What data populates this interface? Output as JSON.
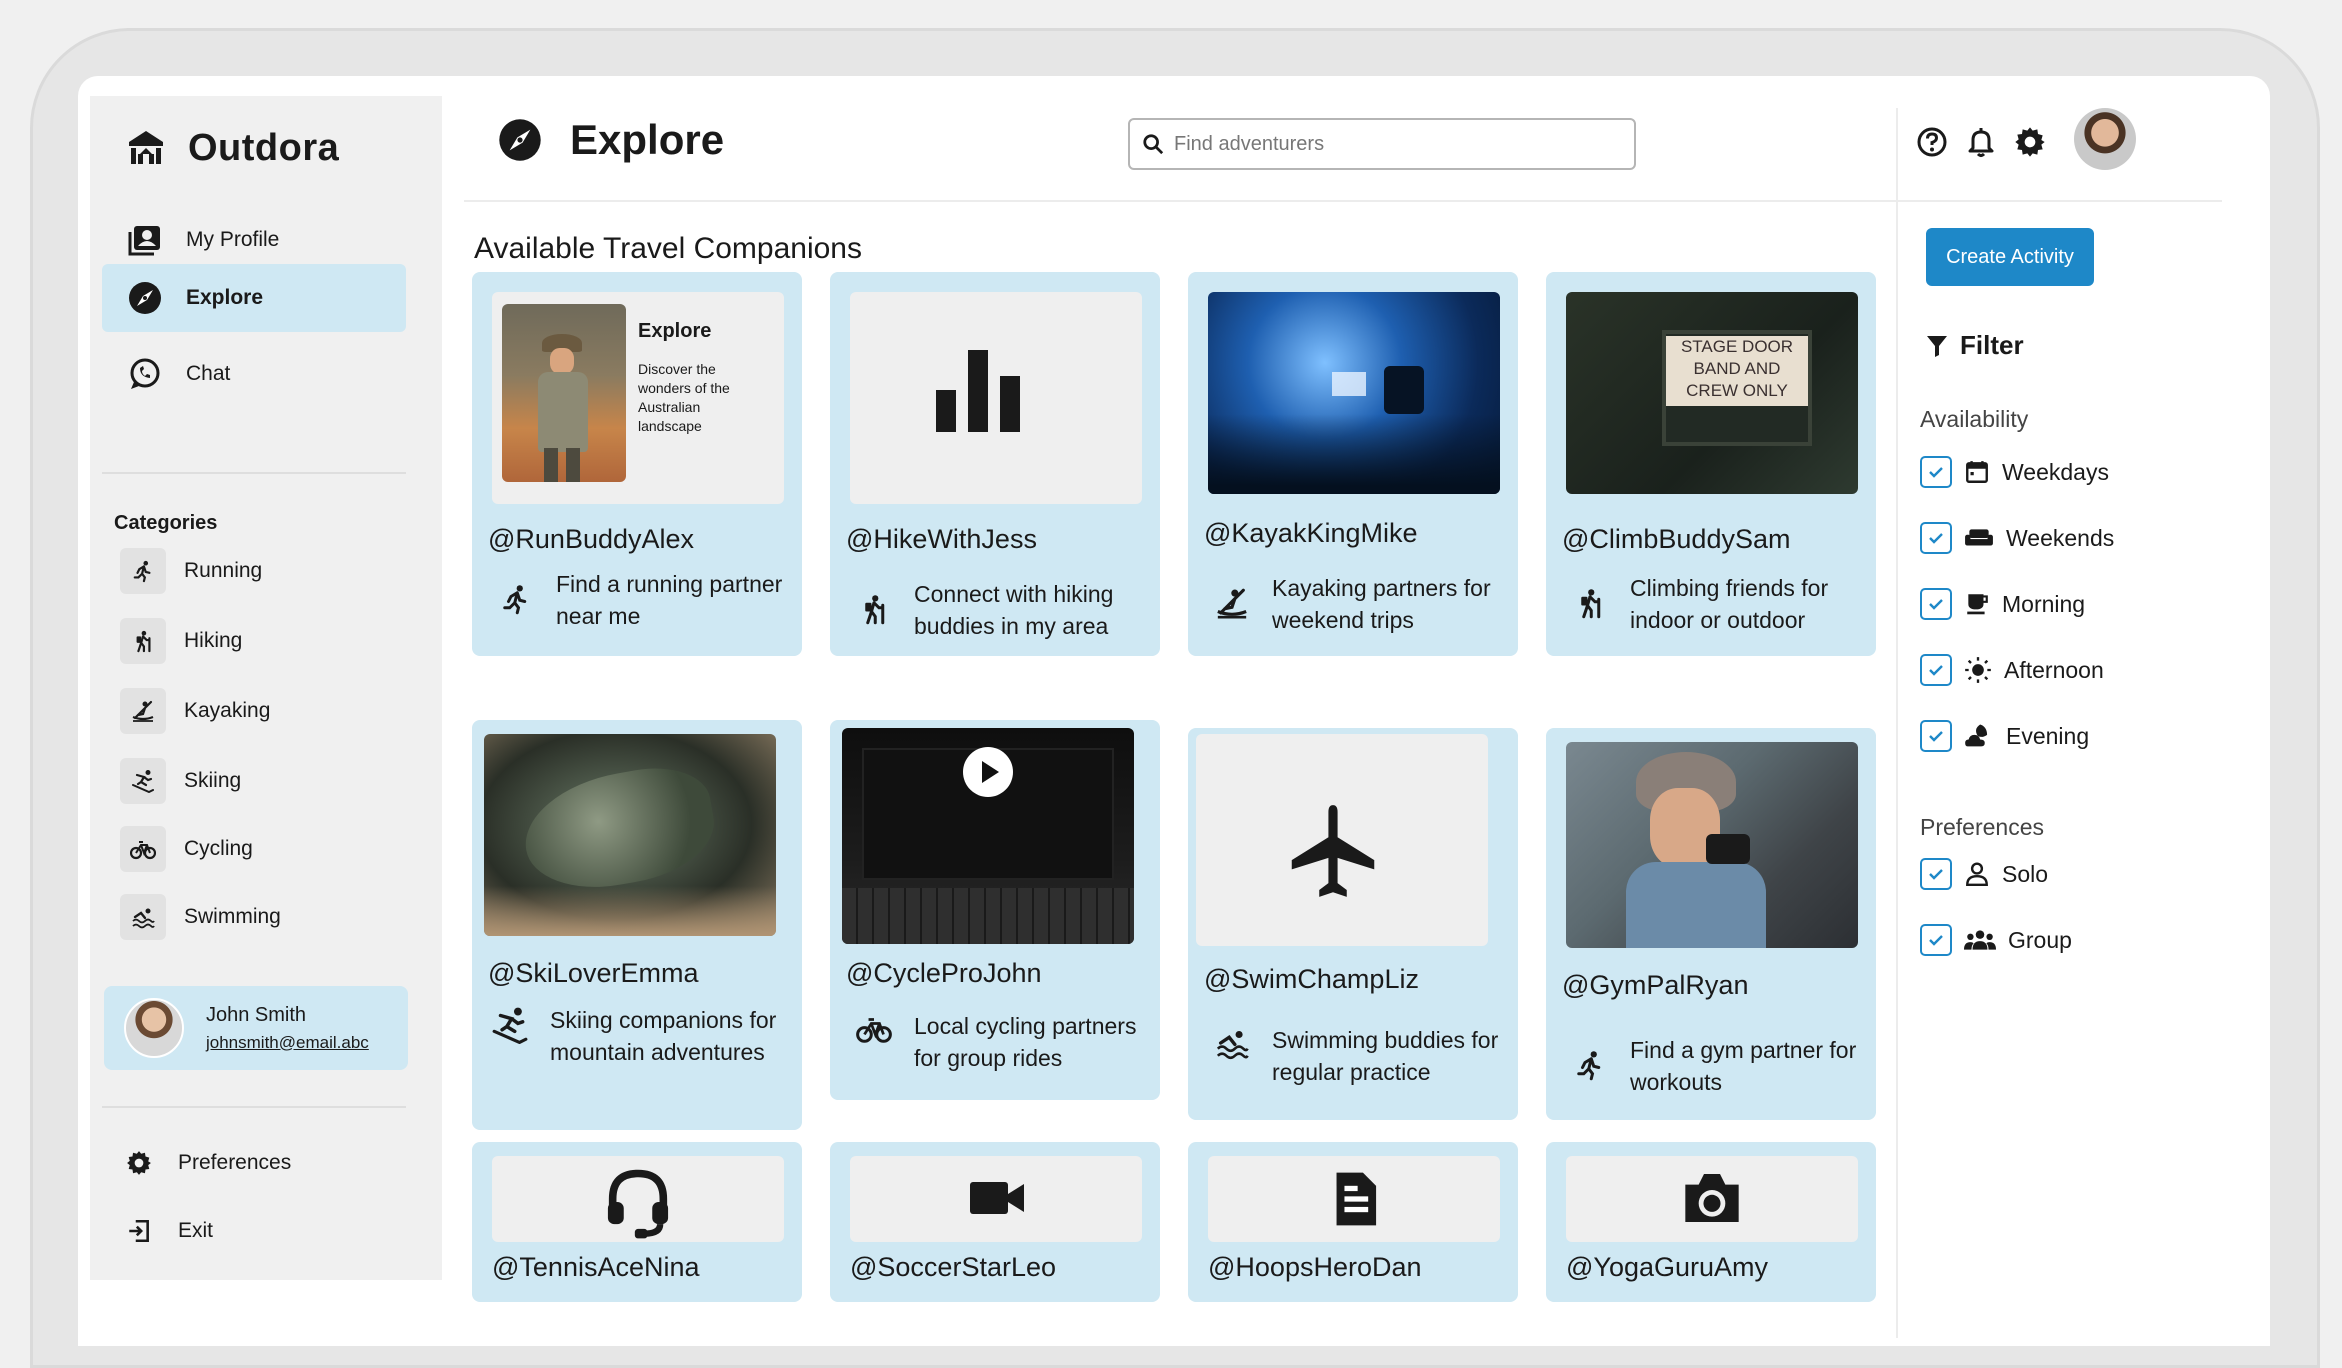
{
  "brand": {
    "name": "Outdora"
  },
  "nav": [
    {
      "label": "My Profile",
      "icon": "profile-icon"
    },
    {
      "label": "Explore",
      "icon": "compass-icon",
      "active": true
    },
    {
      "label": "Chat",
      "icon": "chat-icon"
    }
  ],
  "categories": {
    "heading": "Categories",
    "items": [
      {
        "label": "Running",
        "icon": "running-icon"
      },
      {
        "label": "Hiking",
        "icon": "hiking-icon"
      },
      {
        "label": "Kayaking",
        "icon": "kayaking-icon"
      },
      {
        "label": "Skiing",
        "icon": "skiing-icon"
      },
      {
        "label": "Cycling",
        "icon": "cycling-icon"
      },
      {
        "label": "Swimming",
        "icon": "swimming-icon"
      }
    ]
  },
  "user": {
    "name": "John Smith",
    "email": "johnsmith@email.abc"
  },
  "bottom_nav": [
    {
      "label": "Preferences",
      "icon": "gear-icon"
    },
    {
      "label": "Exit",
      "icon": "exit-icon"
    }
  ],
  "header": {
    "title": "Explore",
    "search_placeholder": "Find adventurers"
  },
  "section_title": "Available Travel Companions",
  "promo": {
    "title": "Explore",
    "text": "Discover the wonders of the Australian landscape"
  },
  "thumb_text": {
    "stage_sign": "STAGE DOOR BAND AND CREW ONLY"
  },
  "cards": [
    {
      "handle": "@RunBuddyAlex",
      "description": "Find a running partner near me",
      "icon": "running-icon",
      "thumb": "promo-card-image"
    },
    {
      "handle": "@HikeWithJess",
      "description": "Connect with hiking buddies in my area",
      "icon": "hiking-icon",
      "thumb": "bar-chart-icon"
    },
    {
      "handle": "@KayakKingMike",
      "description": "Kayaking partners for weekend trips",
      "icon": "kayaking-icon",
      "thumb": "concert-image"
    },
    {
      "handle": "@ClimbBuddySam",
      "description": "Climbing friends for indoor or outdoor",
      "icon": "hiking-icon",
      "thumb": "stage-door-sign-image"
    },
    {
      "handle": "@SkiLoverEmma",
      "description": "Skiing companions for mountain adventures",
      "icon": "skiing-icon",
      "thumb": "lizard-image"
    },
    {
      "handle": "@CycleProJohn",
      "description": "Local cycling partners for group rides",
      "icon": "cycling-icon",
      "thumb": "video-laptop-image"
    },
    {
      "handle": "@SwimChampLiz",
      "description": "Swimming buddies for regular practice",
      "icon": "swimming-icon",
      "thumb": "airplane-icon"
    },
    {
      "handle": "@GymPalRyan",
      "description": "Find a gym partner for workouts",
      "icon": "running-icon",
      "thumb": "photographer-image"
    },
    {
      "handle": "@TennisAceNina",
      "thumb": "headset-icon"
    },
    {
      "handle": "@SoccerStarLeo",
      "thumb": "video-camera-icon"
    },
    {
      "handle": "@HoopsHeroDan",
      "thumb": "document-icon"
    },
    {
      "handle": "@YogaGuruAmy",
      "thumb": "camera-icon"
    }
  ],
  "right_panel": {
    "create_button": "Create Activity",
    "filter_title": "Filter",
    "availability_heading": "Availability",
    "availability": [
      {
        "label": "Weekdays",
        "icon": "calendar-icon",
        "checked": true
      },
      {
        "label": "Weekends",
        "icon": "sofa-icon",
        "checked": true
      },
      {
        "label": "Morning",
        "icon": "coffee-icon",
        "checked": true
      },
      {
        "label": "Afternoon",
        "icon": "sun-icon",
        "checked": true
      },
      {
        "label": "Evening",
        "icon": "moon-cloud-icon",
        "checked": true
      }
    ],
    "preferences_heading": "Preferences",
    "preferences": [
      {
        "label": "Solo",
        "icon": "person-icon",
        "checked": true
      },
      {
        "label": "Group",
        "icon": "group-icon",
        "checked": true
      }
    ]
  },
  "colors": {
    "accent": "#1e88c8",
    "card_bg": "#cfe8f3",
    "sidebar_bg": "#f0f0f0"
  }
}
